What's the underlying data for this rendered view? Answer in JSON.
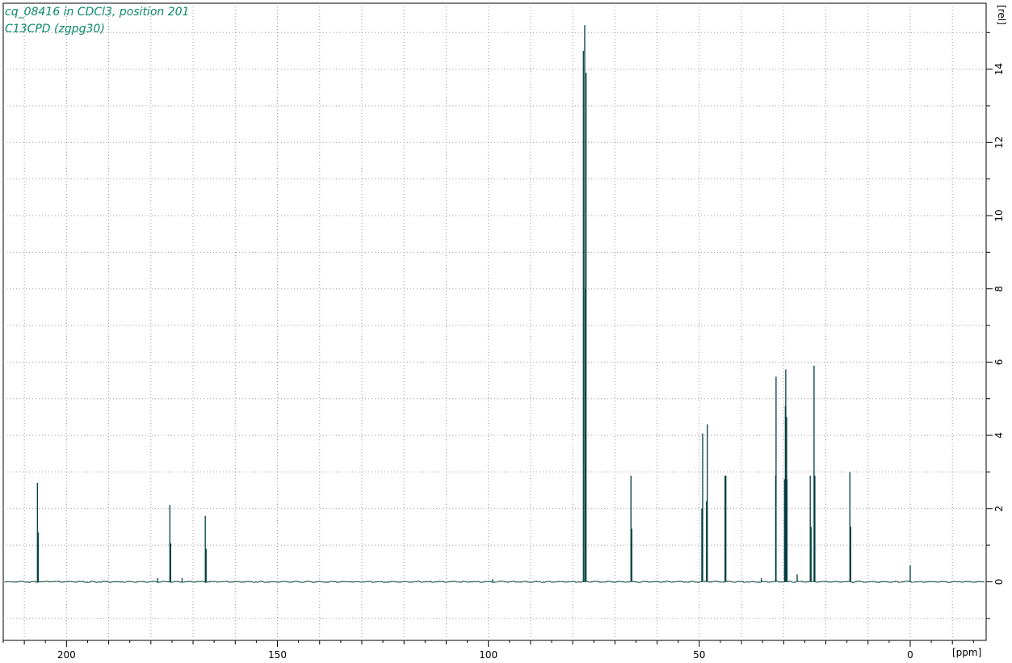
{
  "theme": {
    "spectrum_color": "#003f3f",
    "title_color": "#0b8a6a",
    "frame_color": "#000000"
  },
  "chart_data": {
    "type": "line",
    "title": "cq_08416 in CDCl3, position 201",
    "subtitle": "C13CPD (zgpg30)",
    "xlabel": "[ppm]",
    "ylabel": "[rel]",
    "xlim": [
      215,
      -18
    ],
    "ylim": [
      -1.6,
      15.8
    ],
    "x_ticks": [
      200,
      150,
      100,
      50,
      0
    ],
    "y_ticks": [
      0,
      2,
      4,
      6,
      8,
      10,
      12,
      14
    ],
    "grid": true,
    "x_reversed": true,
    "peaks": [
      {
        "ppm": 206.9,
        "intensity": 2.7
      },
      {
        "ppm": 206.7,
        "intensity": 1.35
      },
      {
        "ppm": 178.4,
        "intensity": 0.1
      },
      {
        "ppm": 175.5,
        "intensity": 2.1
      },
      {
        "ppm": 175.3,
        "intensity": 1.05
      },
      {
        "ppm": 172.6,
        "intensity": 0.1
      },
      {
        "ppm": 167.1,
        "intensity": 1.8
      },
      {
        "ppm": 166.9,
        "intensity": 0.9
      },
      {
        "ppm": 99.0,
        "intensity": 0.07
      },
      {
        "ppm": 77.48,
        "intensity": 14.5
      },
      {
        "ppm": 77.16,
        "intensity": 15.2
      },
      {
        "ppm": 76.84,
        "intensity": 13.9
      },
      {
        "ppm": 77.1,
        "intensity": 8.0
      },
      {
        "ppm": 66.2,
        "intensity": 2.9
      },
      {
        "ppm": 66.0,
        "intensity": 1.45
      },
      {
        "ppm": 49.4,
        "intensity": 2.0
      },
      {
        "ppm": 49.2,
        "intensity": 4.05
      },
      {
        "ppm": 48.3,
        "intensity": 2.2
      },
      {
        "ppm": 48.1,
        "intensity": 4.3
      },
      {
        "ppm": 43.9,
        "intensity": 2.9
      },
      {
        "ppm": 43.7,
        "intensity": 2.9
      },
      {
        "ppm": 35.3,
        "intensity": 0.1
      },
      {
        "ppm": 31.9,
        "intensity": 2.9
      },
      {
        "ppm": 31.8,
        "intensity": 5.6
      },
      {
        "ppm": 29.8,
        "intensity": 2.8
      },
      {
        "ppm": 29.6,
        "intensity": 4.8
      },
      {
        "ppm": 29.5,
        "intensity": 5.8
      },
      {
        "ppm": 29.3,
        "intensity": 4.5
      },
      {
        "ppm": 29.2,
        "intensity": 2.8
      },
      {
        "ppm": 26.8,
        "intensity": 0.2
      },
      {
        "ppm": 23.7,
        "intensity": 2.9
      },
      {
        "ppm": 23.5,
        "intensity": 1.5
      },
      {
        "ppm": 22.8,
        "intensity": 5.9
      },
      {
        "ppm": 22.6,
        "intensity": 2.9
      },
      {
        "ppm": 14.3,
        "intensity": 3.0
      },
      {
        "ppm": 14.1,
        "intensity": 1.5
      },
      {
        "ppm": 0.0,
        "intensity": 0.45
      }
    ]
  }
}
